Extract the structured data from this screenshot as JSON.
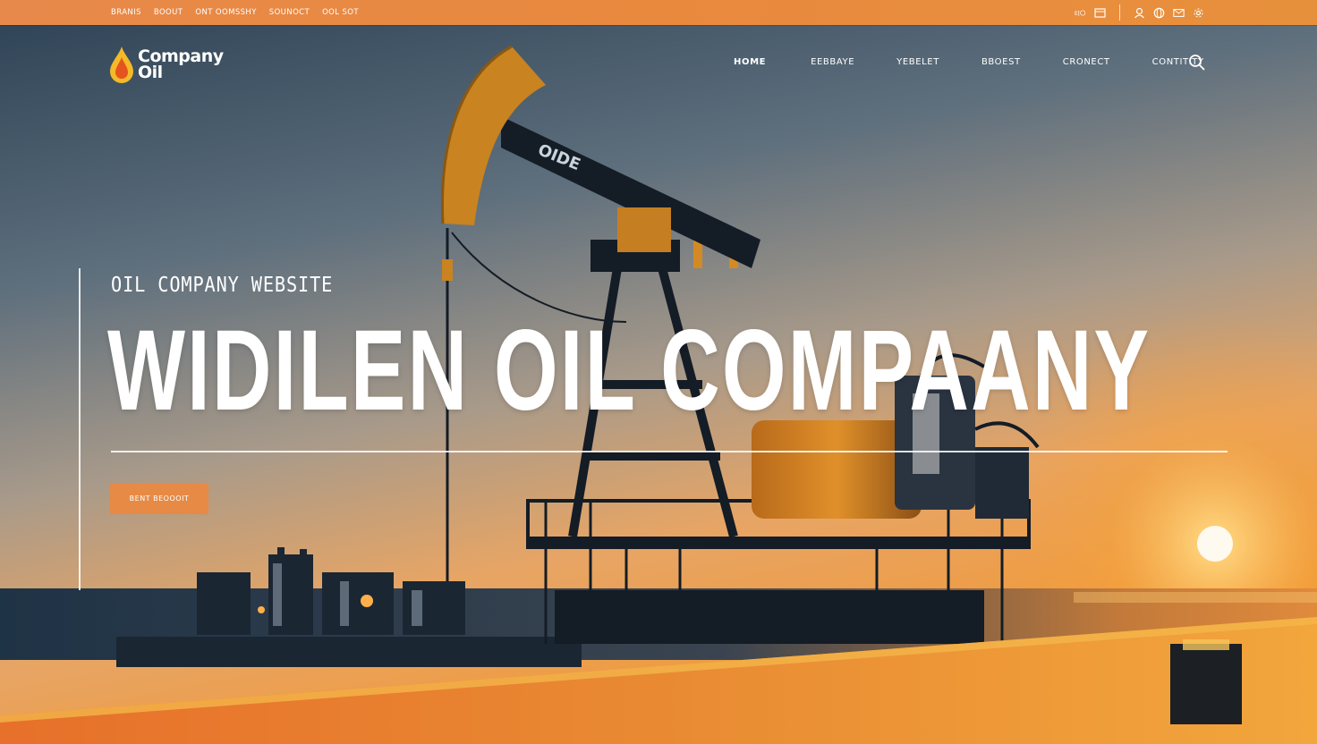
{
  "top_bar": {
    "links": [
      "BRANIS",
      "BOOUT",
      "ONT OOMSSHY",
      "SOUNOCT",
      "OOL SOT"
    ],
    "icons": [
      "translate-icon",
      "calendar-icon",
      "user-icon",
      "globe-icon",
      "mail-icon",
      "settings-icon"
    ]
  },
  "logo": {
    "line1": "Company",
    "line2": "Oil"
  },
  "nav": {
    "items": [
      "HOME",
      "EEBBAYE",
      "YEBELET",
      "BBOEST",
      "CRONECT",
      "CONTITITY"
    ]
  },
  "hero": {
    "eyebrow": "OIL COMPANY WEBSITE",
    "headline": "WIDILEN OIL COMPAANY",
    "cta_label": "BENT BEOOOIT",
    "rig_label": "OIDE"
  },
  "colors": {
    "accent": "#e68a45",
    "top_bar": "#e9893e",
    "sky_top": "#3a4f63",
    "sunset": "#f4a63a"
  }
}
